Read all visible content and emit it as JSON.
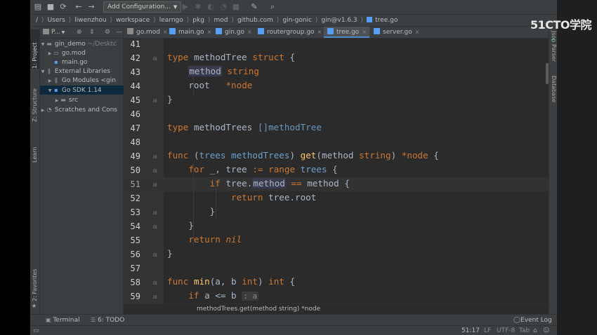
{
  "toolbar": {
    "add_configuration": "Add Configuration...",
    "icons": [
      "folder-icon",
      "save-icon",
      "sync-icon",
      "back-icon",
      "forward-icon",
      "run-icon",
      "debug-icon",
      "coverage-icon",
      "profile-icon",
      "stop-icon",
      "wrench-icon",
      "search-icon"
    ]
  },
  "breadcrumb": [
    "/",
    "Users",
    "liwenzhou",
    "workspace",
    "learngo",
    "pkg",
    "mod",
    "github.com",
    "gin-gonic",
    "gin@v1.6.3",
    "tree.go"
  ],
  "left_strip": {
    "project": "1: Project",
    "structure": "Z: Structure",
    "learn": "Learn",
    "favorites": "2: Favorites"
  },
  "right_strip": {
    "json_parser": "Json Parser",
    "database": "Database"
  },
  "project_panel": {
    "header": "P...",
    "items": [
      {
        "label": "gin_demo",
        "extra": "~/Desktc"
      },
      {
        "label": "go.mod"
      },
      {
        "label": "main.go"
      },
      {
        "label": "External Libraries"
      },
      {
        "label": "Go Modules <gin"
      },
      {
        "label": "Go SDK 1.14"
      },
      {
        "label": "src"
      },
      {
        "label": "Scratches and Cons"
      }
    ]
  },
  "tabs": [
    "go.mod",
    "main.go",
    "gin.go",
    "routergroup.go",
    "tree.go",
    "server.go"
  ],
  "active_tab": "tree.go",
  "line_numbers": [
    "41",
    "42",
    "43",
    "44",
    "45",
    "46",
    "47",
    "48",
    "49",
    "50",
    "51",
    "52",
    "53",
    "54",
    "55",
    "56",
    "57",
    "58",
    "59"
  ],
  "signature": "methodTrees.get(method string) *node",
  "tool_buttons": {
    "terminal": "Terminal",
    "todo": "6: TODO",
    "event_log": "Event Log"
  },
  "status": {
    "position": "51:17",
    "line_sep": "LF",
    "encoding": "UTF-8",
    "indent": "Tab"
  },
  "watermark": "51CTO学院",
  "code": {
    "l42": {
      "kw": "type",
      "name": "methodTree",
      "kw2": "struct",
      "brace": "{"
    },
    "l43": {
      "field": "method",
      "type": "string"
    },
    "l44": {
      "field": "root",
      "star": "*",
      "type": "node"
    },
    "l45": {
      "brace": "}"
    },
    "l47": {
      "kw": "type",
      "name": "methodTrees",
      "type": "[]methodTree"
    },
    "l49": {
      "kw": "func",
      "open": "(",
      "recv": "trees",
      "recvtype": "methodTrees",
      "close": ")",
      "fn": "get",
      "open2": "(",
      "param": "method",
      "ptype": "string",
      "close2": ")",
      "star": "*",
      "rtype": "node",
      "brace": "{"
    },
    "l50": {
      "kw": "for",
      "vars": "_, tree",
      "op": ":=",
      "range": "range",
      "ident": "trees",
      "brace": "{"
    },
    "l51": {
      "kw": "if",
      "lhs": "tree.",
      "field": "method",
      "op": "==",
      "rhs": "method",
      "brace": "{"
    },
    "l52": {
      "kw": "return",
      "expr": "tree.root"
    },
    "l53": {
      "brace": "}"
    },
    "l54": {
      "brace": "}"
    },
    "l55": {
      "kw": "return",
      "nil": "nil"
    },
    "l56": {
      "brace": "}"
    },
    "l58": {
      "kw": "func",
      "fn": "min",
      "params": "(a, b",
      "ptype": "int",
      "close": ")",
      "rtype": "int",
      "brace": "{"
    },
    "l59": {
      "kw": "if",
      "expr": "a <= b",
      "hint": ": a"
    }
  }
}
